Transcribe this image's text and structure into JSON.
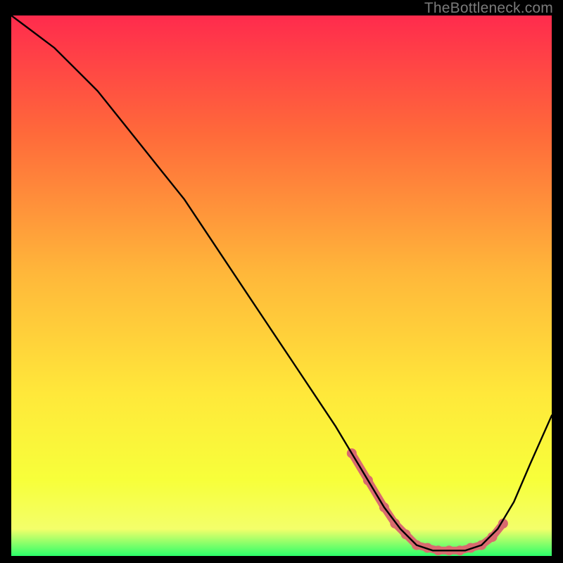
{
  "watermark": "TheBottleneck.com",
  "colors": {
    "grad_top": "#ff2b4d",
    "grad_mid1": "#ff6a3a",
    "grad_mid2": "#ffb83a",
    "grad_mid3": "#ffe83a",
    "grad_mid4": "#f7ff3a",
    "grad_bottom_yellow": "#f4ff6a",
    "grad_green": "#2cff6a",
    "curve": "#000000",
    "marker": "#d96a6f",
    "frame_bg": "#000000"
  },
  "chart_data": {
    "type": "line",
    "title": "",
    "xlabel": "",
    "ylabel": "",
    "xlim": [
      0,
      100
    ],
    "ylim": [
      0,
      100
    ],
    "series": [
      {
        "name": "bottleneck-curve",
        "x": [
          0,
          4,
          8,
          12,
          16,
          20,
          24,
          28,
          32,
          36,
          40,
          44,
          48,
          52,
          56,
          60,
          63,
          66,
          69,
          72,
          75,
          78,
          81,
          84,
          87,
          90,
          93,
          96,
          100
        ],
        "y": [
          100,
          97,
          94,
          90,
          86,
          81,
          76,
          71,
          66,
          60,
          54,
          48,
          42,
          36,
          30,
          24,
          19,
          14,
          9,
          5,
          2,
          1,
          1,
          1,
          2,
          5,
          10,
          17,
          26
        ]
      }
    ],
    "markers": {
      "name": "highlight-run",
      "x": [
        63,
        66,
        69,
        71,
        73,
        75,
        77,
        79,
        81,
        83,
        85,
        87,
        89,
        91
      ],
      "y": [
        19,
        14,
        9,
        6,
        4,
        2,
        1.5,
        1,
        1,
        1,
        1.5,
        2,
        3.5,
        6
      ]
    }
  }
}
